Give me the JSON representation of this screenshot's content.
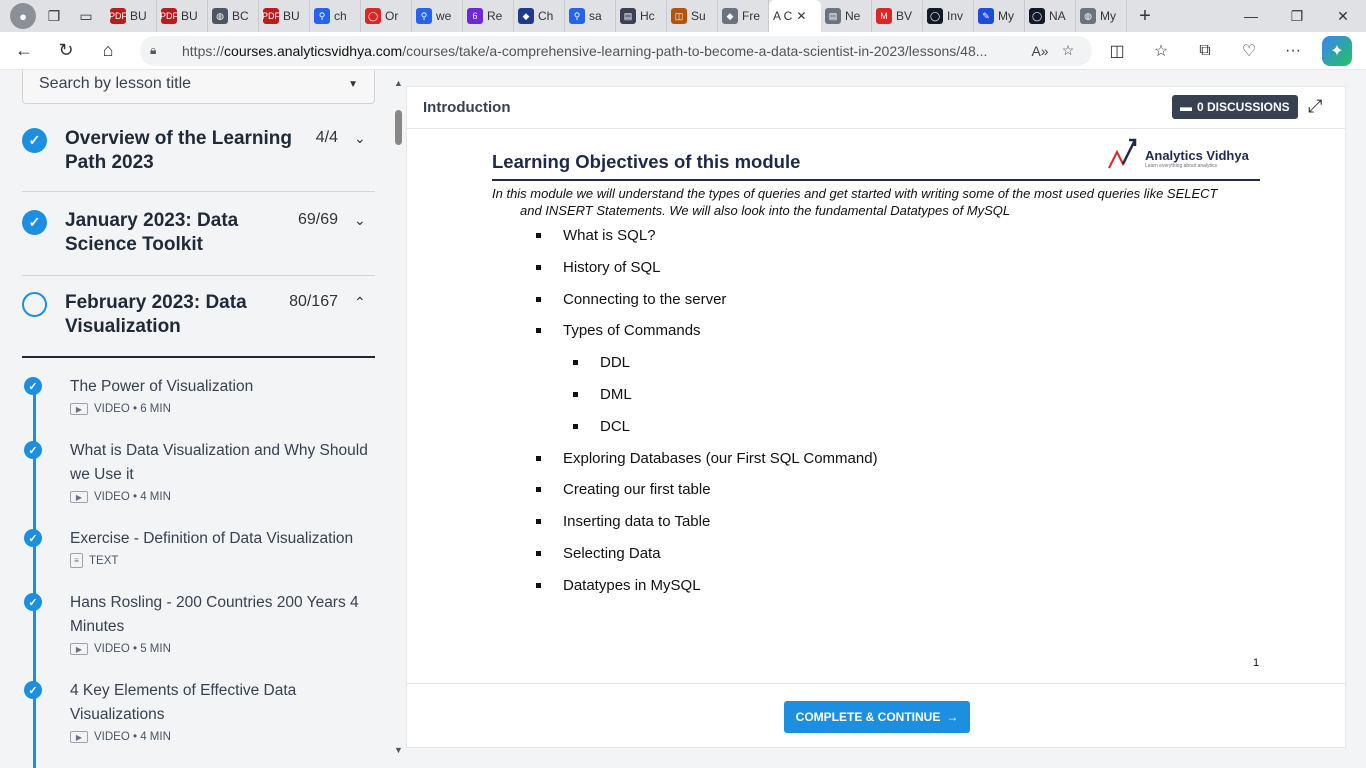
{
  "browser": {
    "tabs": [
      {
        "label": "BU",
        "color": "#b91c1c",
        "glyph": "PDF"
      },
      {
        "label": "BU",
        "color": "#b91c1c",
        "glyph": "PDF"
      },
      {
        "label": "BC",
        "color": "#4b5563",
        "glyph": "◍"
      },
      {
        "label": "BU",
        "color": "#b91c1c",
        "glyph": "PDF"
      },
      {
        "label": "ch",
        "color": "#2563eb",
        "glyph": "⚲"
      },
      {
        "label": "Or",
        "color": "#dc2626",
        "glyph": "◯"
      },
      {
        "label": "we",
        "color": "#2563eb",
        "glyph": "⚲"
      },
      {
        "label": "Re",
        "color": "#6d28d9",
        "glyph": "6"
      },
      {
        "label": "Ch",
        "color": "#1e3a8a",
        "glyph": "◆"
      },
      {
        "label": "sa",
        "color": "#2563eb",
        "glyph": "⚲"
      },
      {
        "label": "Hc",
        "color": "#374151",
        "glyph": "▤"
      },
      {
        "label": "Su",
        "color": "#b45309",
        "glyph": "◫"
      },
      {
        "label": "Fre",
        "color": "#6b7280",
        "glyph": "◆"
      }
    ],
    "active_tab": {
      "label": "A C",
      "close": "✕"
    },
    "tabs_after": [
      {
        "label": "Ne",
        "color": "#6b7280",
        "glyph": "▤"
      },
      {
        "label": "BV",
        "color": "#dc2626",
        "glyph": "M"
      },
      {
        "label": "Inv",
        "color": "#111827",
        "glyph": "◯"
      },
      {
        "label": "My",
        "color": "#1d4ed8",
        "glyph": "✎"
      },
      {
        "label": "NA",
        "color": "#111827",
        "glyph": "◯"
      },
      {
        "label": "My",
        "color": "#6b7280",
        "glyph": "◍"
      }
    ],
    "new_tab": "+",
    "url_prefix": "https://",
    "url_domain": "courses.analyticsvidhya.com",
    "url_rest": "/courses/take/a-comprehensive-learning-path-to-become-a-data-scientist-in-2023/lessons/48..."
  },
  "sidebar": {
    "search_placeholder": "Search by lesson title",
    "sections": [
      {
        "title": "Overview of the Learning Path 2023",
        "count": "4/4",
        "complete": true
      },
      {
        "title": "January 2023: Data Science Toolkit",
        "count": "69/69",
        "complete": true
      },
      {
        "title": "February 2023: Data Visualization",
        "count": "80/167",
        "complete": false
      }
    ],
    "lessons": [
      {
        "title": "The Power of Visualization",
        "meta": "VIDEO • 6 MIN"
      },
      {
        "title": "What is Data Visualization and Why Should we Use it",
        "meta": "VIDEO • 4 MIN"
      },
      {
        "title": "Exercise - Definition of Data Visualization",
        "meta": "TEXT"
      },
      {
        "title": "Hans Rosling - 200 Countries 200 Years 4 Minutes",
        "meta": "VIDEO • 5 MIN"
      },
      {
        "title": "4 Key Elements of Effective Data Visualizations",
        "meta": "VIDEO • 4 MIN"
      }
    ]
  },
  "content": {
    "header_title": "Introduction",
    "discussions_label": "0 DISCUSSIONS",
    "slide": {
      "title": "Learning Objectives of this module",
      "logo_name": "Analytics Vidhya",
      "logo_tagline": "Learn everything about analytics",
      "intro_line1": "In this module we will understand the types of queries and get started with writing some of the most used queries like SELECT",
      "intro_line2": "and INSERT Statements. We will also look into the fundamental Datatypes of MySQL",
      "objectives": [
        {
          "text": "What is SQL?",
          "level": 1
        },
        {
          "text": "History of SQL",
          "level": 1
        },
        {
          "text": "Connecting to the server",
          "level": 1
        },
        {
          "text": "Types of Commands",
          "level": 1
        },
        {
          "text": "DDL",
          "level": 2
        },
        {
          "text": "DML",
          "level": 2
        },
        {
          "text": "DCL",
          "level": 2
        },
        {
          "text": "Exploring Databases (our First SQL Command)",
          "level": 1
        },
        {
          "text": "Creating our first table",
          "level": 1
        },
        {
          "text": "Inserting data to Table",
          "level": 1
        },
        {
          "text": "Selecting Data",
          "level": 1
        },
        {
          "text": "Datatypes in MySQL",
          "level": 1
        }
      ],
      "page_number": "1"
    },
    "complete_button": "COMPLETE & CONTINUE",
    "complete_arrow": "→"
  },
  "colors": {
    "accent": "#1d8fe1",
    "dark": "#374151",
    "slide_title": "#1e2a4a"
  }
}
